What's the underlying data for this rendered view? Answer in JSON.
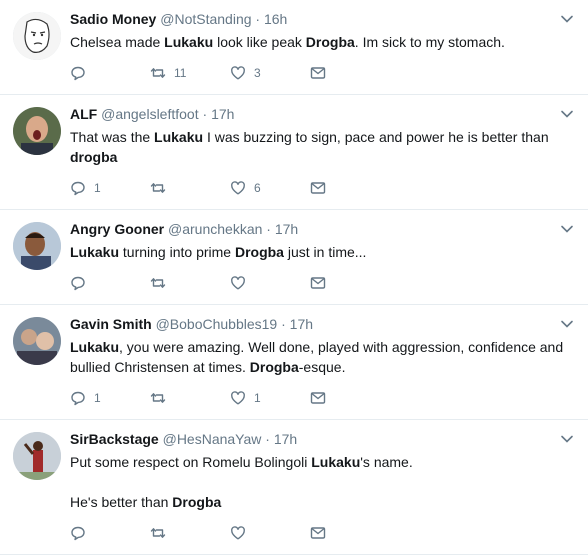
{
  "tweets": [
    {
      "name": "Sadio Money",
      "handle": "@NotStanding",
      "time": "16h",
      "parts": [
        {
          "t": "Chelsea made "
        },
        {
          "b": "Lukaku"
        },
        {
          "t": " look like peak "
        },
        {
          "b": "Drogba"
        },
        {
          "t": ". Im sick to my stomach."
        }
      ],
      "replies": "",
      "retweets": "11",
      "likes": "3",
      "avatar": "meme-face"
    },
    {
      "name": "ALF",
      "handle": "@angelsleftfoot",
      "time": "17h",
      "parts": [
        {
          "t": "That was the "
        },
        {
          "b": "Lukaku"
        },
        {
          "t": " I was buzzing to sign, pace and power he is better than "
        },
        {
          "b": "drogba"
        }
      ],
      "replies": "1",
      "retweets": "",
      "likes": "6",
      "avatar": "shouting-man"
    },
    {
      "name": "Angry Gooner",
      "handle": "@arunchekkan",
      "time": "17h",
      "parts": [
        {
          "b": "Lukaku"
        },
        {
          "t": " turning into prime "
        },
        {
          "b": "Drogba"
        },
        {
          "t": " just in time..."
        }
      ],
      "replies": "",
      "retweets": "",
      "likes": "",
      "avatar": "man-photo"
    },
    {
      "name": "Gavin Smith",
      "handle": "@BoboChubbles19",
      "time": "17h",
      "parts": [
        {
          "b": "Lukaku"
        },
        {
          "t": ", you were amazing. Well done, played with aggression, confidence and bullied Christensen at times. "
        },
        {
          "b": "Drogba"
        },
        {
          "t": "-esque."
        }
      ],
      "replies": "1",
      "retweets": "",
      "likes": "1",
      "avatar": "group-photo"
    },
    {
      "name": "SirBackstage",
      "handle": "@HesNanaYaw",
      "time": "17h",
      "parts": [
        {
          "t": "Put some respect on Romelu Bolingoli "
        },
        {
          "b": "Lukaku"
        },
        {
          "t": "'s name."
        },
        {
          "br": true
        },
        {
          "br": true
        },
        {
          "t": "He's better than "
        },
        {
          "b": "Drogba"
        }
      ],
      "replies": "",
      "retweets": "",
      "likes": "",
      "avatar": "player-photo"
    }
  ],
  "colors": {
    "text": "#14171a",
    "muted": "#657786",
    "border": "#e6ecf0"
  }
}
